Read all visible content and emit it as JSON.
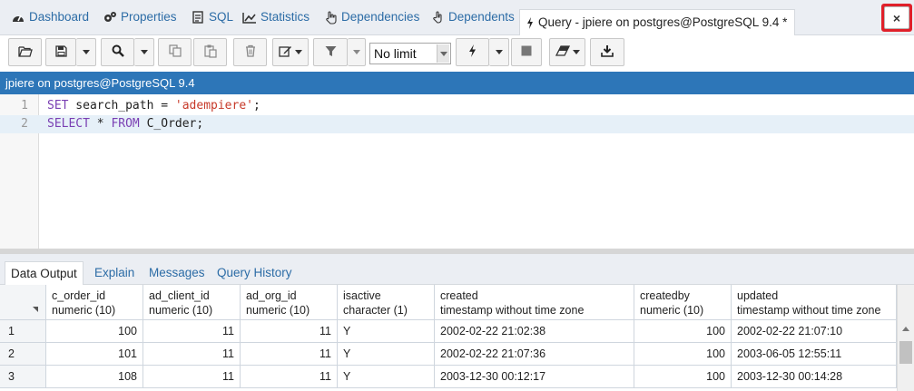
{
  "tabs": [
    {
      "label": "Dashboard",
      "icon": "dashboard-icon"
    },
    {
      "label": "Properties",
      "icon": "gears-icon"
    },
    {
      "label": "SQL",
      "icon": "file-text-icon"
    },
    {
      "label": "Statistics",
      "icon": "line-chart-icon"
    },
    {
      "label": "Dependencies",
      "icon": "hand-pointer-icon"
    },
    {
      "label": "Dependents",
      "icon": "hand-up-icon"
    },
    {
      "label": "Query - jpiere on postgres@PostgreSQL 9.4 *",
      "icon": "bolt-icon"
    }
  ],
  "close_glyph": "×",
  "toolbar": {
    "limit_value": "No limit"
  },
  "connection_label": "jpiere on postgres@PostgreSQL 9.4",
  "editor": {
    "line_numbers": [
      "1",
      "2"
    ],
    "line1": {
      "kw": "SET",
      "mid": " search_path = ",
      "str": "'adempiere'",
      "end": ";"
    },
    "line2": {
      "kw1": "SELECT",
      "mid1": " * ",
      "kw2": "FROM",
      "end": " C_Order;"
    }
  },
  "bottom_tabs": [
    "Data Output",
    "Explain",
    "Messages",
    "Query History"
  ],
  "grid": {
    "columns": [
      {
        "name": "c_order_id",
        "type": "numeric (10)"
      },
      {
        "name": "ad_client_id",
        "type": "numeric (10)"
      },
      {
        "name": "ad_org_id",
        "type": "numeric (10)"
      },
      {
        "name": "isactive",
        "type": "character (1)"
      },
      {
        "name": "created",
        "type": "timestamp without time zone"
      },
      {
        "name": "createdby",
        "type": "numeric (10)"
      },
      {
        "name": "updated",
        "type": "timestamp without time zone"
      }
    ],
    "rows": [
      {
        "n": "1",
        "cells": [
          "100",
          "11",
          "11",
          "Y",
          "2002-02-22 21:02:38",
          "100",
          "2002-02-22 21:07:10"
        ]
      },
      {
        "n": "2",
        "cells": [
          "101",
          "11",
          "11",
          "Y",
          "2002-02-22 21:07:36",
          "100",
          "2003-06-05 12:55:11"
        ]
      },
      {
        "n": "3",
        "cells": [
          "108",
          "11",
          "11",
          "Y",
          "2003-12-30 00:12:17",
          "100",
          "2003-12-30 00:14:28"
        ]
      }
    ]
  },
  "colors": {
    "accent": "#2d76b8",
    "link": "#2c6ca6",
    "highlight": "#e0202a"
  }
}
